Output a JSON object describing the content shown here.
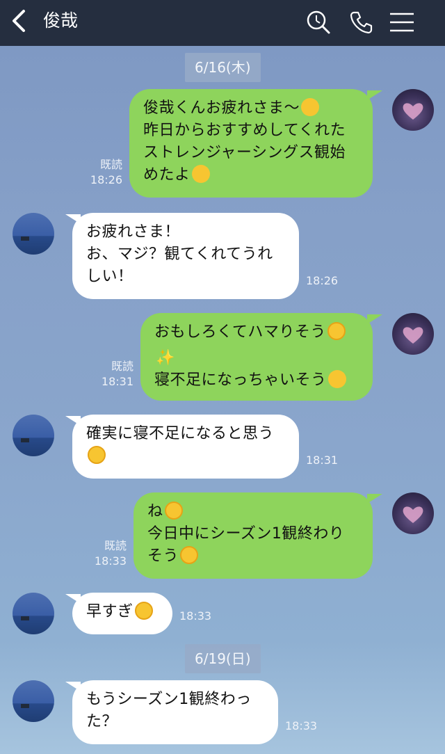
{
  "header": {
    "title": "俊哉"
  },
  "dates": [
    "6/16(木)",
    "6/19(日)"
  ],
  "messages": [
    {
      "from": "me",
      "lines": [
        "俊哉くんお疲れさま〜",
        "昨日からおすすめしてくれた",
        "ストレンジャーシングス観始",
        "めたよ"
      ],
      "read": "既読",
      "time": "18:26"
    },
    {
      "from": "them",
      "lines": [
        "お疲れさま！",
        "お、マジ？観てくれてうれ",
        "しい！"
      ],
      "time": "18:26"
    },
    {
      "from": "me",
      "lines": [
        "おもしろくてハマりそう",
        "",
        "寝不足になっちゃいそう"
      ],
      "read": "既読",
      "time": "18:31"
    },
    {
      "from": "them",
      "lines": [
        "確実に寝不足になると思う",
        ""
      ],
      "time": "18:31"
    },
    {
      "from": "me",
      "lines": [
        "ね",
        "今日中にシーズン1観終わり",
        "そう"
      ],
      "read": "既読",
      "time": "18:33"
    },
    {
      "from": "them",
      "lines": [
        "早すぎ"
      ],
      "time": "18:33"
    },
    {
      "from": "them",
      "lines": [
        "もうシーズン1観終わっ",
        "た？"
      ],
      "time": "18:33"
    }
  ],
  "icons": [
    "back-chevron-icon",
    "search-icon",
    "phone-icon",
    "menu-icon",
    "smiling-face-icon",
    "hand-over-mouth-icon",
    "rolling-laughing-icon",
    "sparkles-icon",
    "tears-of-joy-icon"
  ]
}
